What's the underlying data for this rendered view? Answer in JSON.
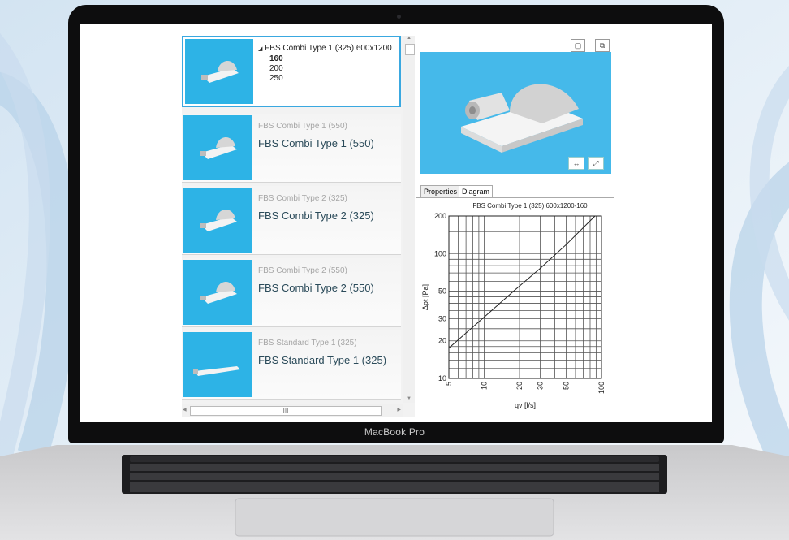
{
  "device": {
    "label": "MacBook Pro"
  },
  "list": {
    "selected": {
      "title": "FBS Combi Type 1 (325) 600x1200",
      "sizes": [
        "160",
        "200",
        "250"
      ],
      "active_size": "160"
    },
    "items": [
      {
        "subtitle": "FBS Combi Type 1 (550)",
        "name": "FBS Combi Type 1 (550)"
      },
      {
        "subtitle": "FBS Combi Type 2 (325)",
        "name": "FBS Combi Type 2 (325)"
      },
      {
        "subtitle": "FBS Combi Type 2 (550)",
        "name": "FBS Combi Type 2 (550)"
      },
      {
        "subtitle": "FBS Standard Type 1 (325)",
        "name": "FBS Standard Type 1 (325)"
      }
    ],
    "scroll_thumb": "III"
  },
  "tabs": {
    "properties": "Properties",
    "diagram": "Diagram"
  },
  "icons": {
    "view_toggle_1": "box-outline-icon",
    "view_toggle_2": "stacked-boxes-icon",
    "measure": "width-measure-icon",
    "fullscreen": "expand-icon"
  },
  "colors": {
    "accent": "#2db3e6",
    "selection_border": "#3aa8e0"
  },
  "chart_data": {
    "type": "line",
    "title": "FBS Combi Type 1 (325) 600x1200-160",
    "xlabel": "qv [l/s]",
    "ylabel": "Δpt [Pa]",
    "x_scale": "log",
    "y_scale": "log",
    "xlim": [
      5,
      100
    ],
    "ylim": [
      10,
      200
    ],
    "x_ticks": [
      "5",
      "10",
      "20",
      "30",
      "50",
      "100"
    ],
    "y_ticks": [
      "10",
      "20",
      "30",
      "50",
      "100",
      "200"
    ],
    "grid": true,
    "series": [
      {
        "x": [
          5,
          10,
          20,
          30,
          50,
          88
        ],
        "y": [
          17.5,
          31,
          55,
          76,
          118,
          200
        ]
      }
    ]
  }
}
